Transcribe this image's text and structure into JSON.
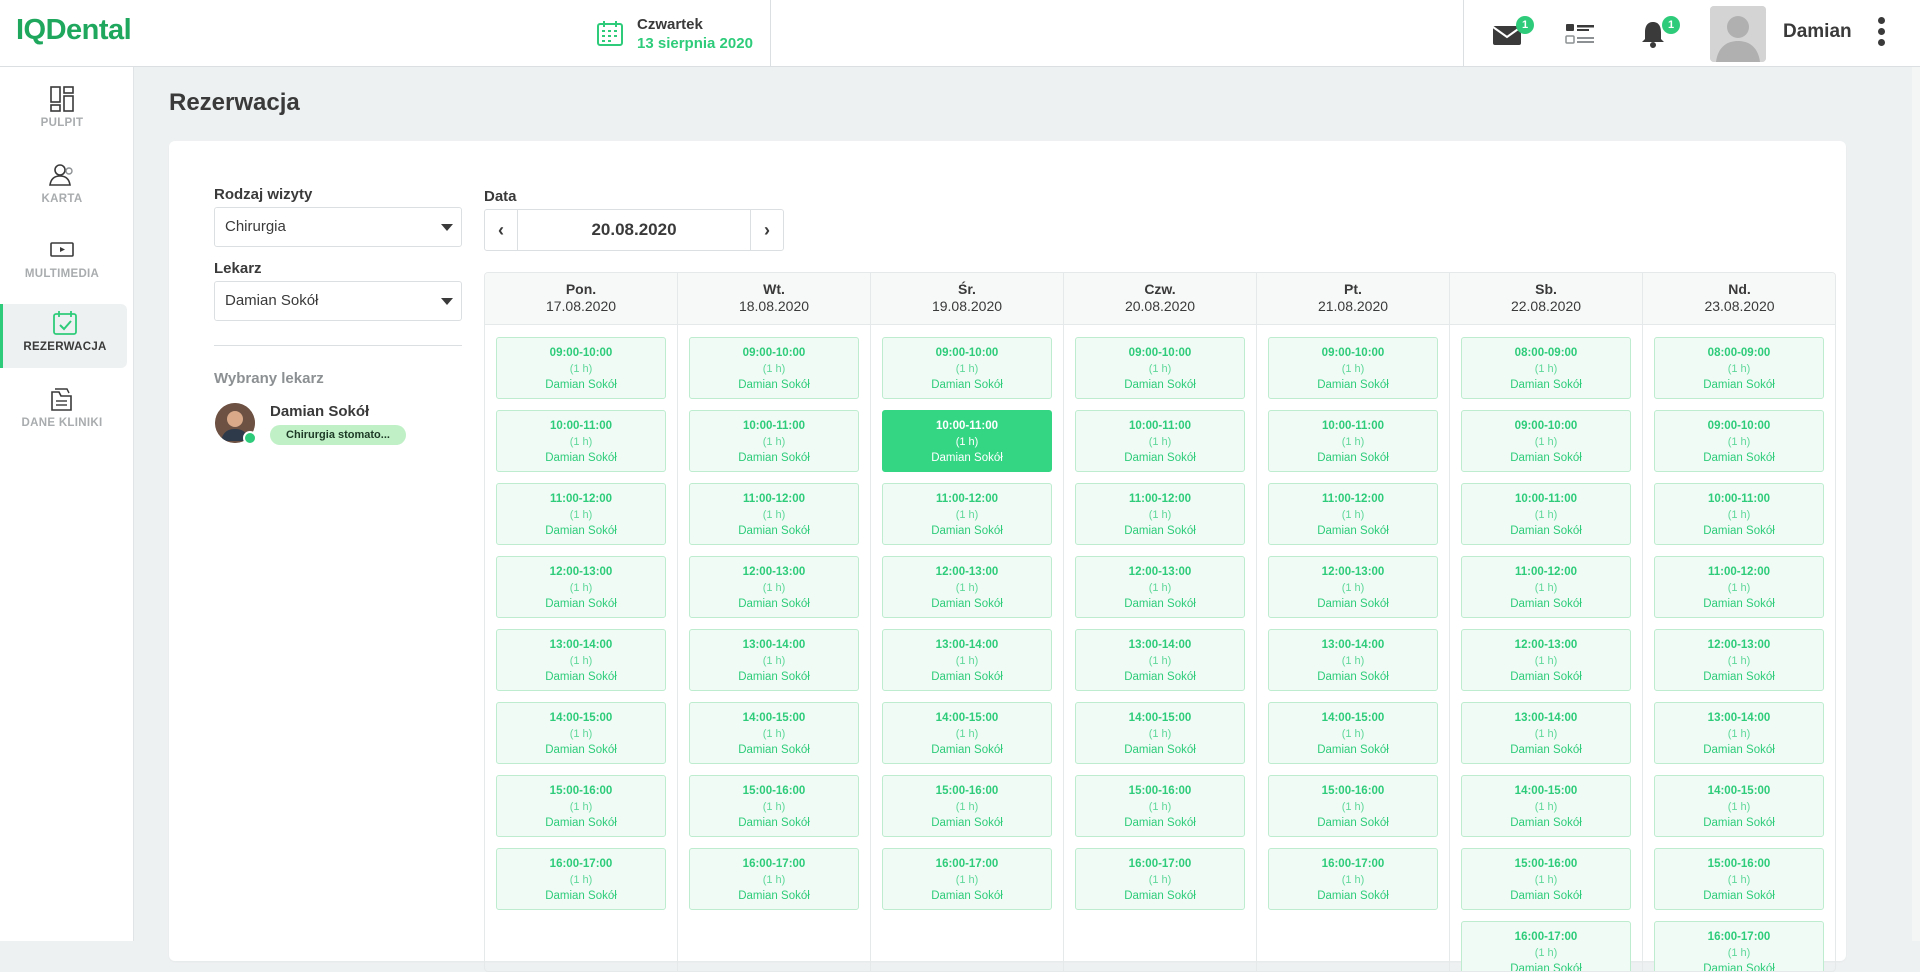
{
  "app": {
    "logo": "IQDental"
  },
  "header": {
    "weekday": "Czwartek",
    "date": "13 sierpnia 2020",
    "messages_badge": "1",
    "notifications_badge": "1",
    "username": "Damian"
  },
  "sidebar": {
    "items": [
      {
        "label": "PULPIT",
        "icon": "dashboard-icon"
      },
      {
        "label": "KARTA",
        "icon": "patients-icon"
      },
      {
        "label": "MULTIMEDIA",
        "icon": "multimedia-icon"
      },
      {
        "label": "REZERWACJA",
        "icon": "calendar-check-icon",
        "active": true
      },
      {
        "label": "DANE KLINIKI",
        "icon": "clinic-data-icon"
      }
    ]
  },
  "page": {
    "title": "Rezerwacja",
    "visit_type_label": "Rodzaj wizyty",
    "visit_type_value": "Chirurgia",
    "doctor_label": "Lekarz",
    "doctor_value": "Damian Sokół",
    "selected_doctor_label": "Wybrany lekarz",
    "selected_doctor_name": "Damian Sokół",
    "selected_doctor_spec": "Chirurgia stomato...",
    "date_label": "Data",
    "date_value": "20.08.2020"
  },
  "week": {
    "days": [
      {
        "name": "Pon.",
        "date": "17.08.2020",
        "slots": [
          "09:00-10:00",
          "10:00-11:00",
          "11:00-12:00",
          "12:00-13:00",
          "13:00-14:00",
          "14:00-15:00",
          "15:00-16:00",
          "16:00-17:00"
        ]
      },
      {
        "name": "Wt.",
        "date": "18.08.2020",
        "slots": [
          "09:00-10:00",
          "10:00-11:00",
          "11:00-12:00",
          "12:00-13:00",
          "13:00-14:00",
          "14:00-15:00",
          "15:00-16:00",
          "16:00-17:00"
        ]
      },
      {
        "name": "Śr.",
        "date": "19.08.2020",
        "slots": [
          "09:00-10:00",
          "10:00-11:00",
          "11:00-12:00",
          "12:00-13:00",
          "13:00-14:00",
          "14:00-15:00",
          "15:00-16:00",
          "16:00-17:00"
        ],
        "selected": 1
      },
      {
        "name": "Czw.",
        "date": "20.08.2020",
        "slots": [
          "09:00-10:00",
          "10:00-11:00",
          "11:00-12:00",
          "12:00-13:00",
          "13:00-14:00",
          "14:00-15:00",
          "15:00-16:00",
          "16:00-17:00"
        ]
      },
      {
        "name": "Pt.",
        "date": "21.08.2020",
        "slots": [
          "09:00-10:00",
          "10:00-11:00",
          "11:00-12:00",
          "12:00-13:00",
          "13:00-14:00",
          "14:00-15:00",
          "15:00-16:00",
          "16:00-17:00"
        ]
      },
      {
        "name": "Sb.",
        "date": "22.08.2020",
        "slots": [
          "08:00-09:00",
          "09:00-10:00",
          "10:00-11:00",
          "11:00-12:00",
          "12:00-13:00",
          "13:00-14:00",
          "14:00-15:00",
          "15:00-16:00",
          "16:00-17:00"
        ]
      },
      {
        "name": "Nd.",
        "date": "23.08.2020",
        "slots": [
          "08:00-09:00",
          "09:00-10:00",
          "10:00-11:00",
          "11:00-12:00",
          "12:00-13:00",
          "13:00-14:00",
          "14:00-15:00",
          "15:00-16:00",
          "16:00-17:00"
        ]
      }
    ],
    "slot_duration": "(1 h)",
    "slot_doctor": "Damian Sokół"
  },
  "colors": {
    "accent": "#2ecc7a",
    "brand": "#1fa75e"
  }
}
